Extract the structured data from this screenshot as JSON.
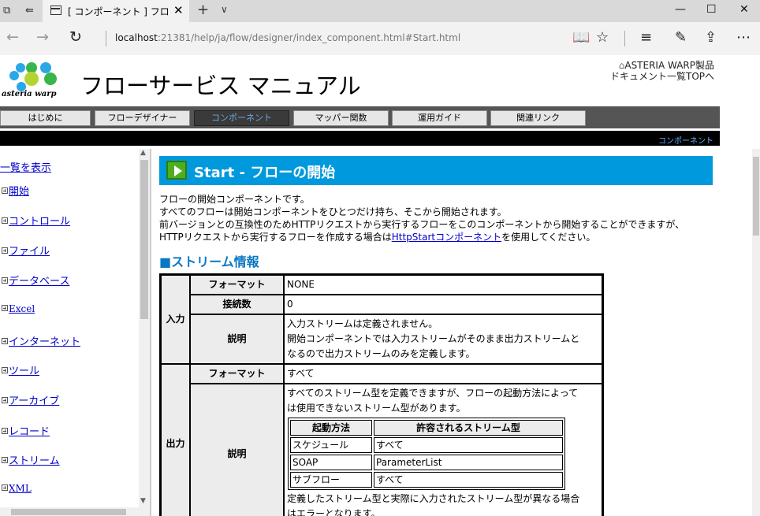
{
  "browser": {
    "tab_title": "[ コンポーネント ] フローサービ",
    "url_host": "localhost",
    "url_rest": ":21381/help/ja/flow/designer/index_component.html#Start.html"
  },
  "header": {
    "logo_text": "asteria warp",
    "title": "フローサービス マニュアル",
    "top_link_line1": "ASTERIA WARP製品",
    "top_link_line2": "ドキュメント一覧TOPへ"
  },
  "menu": {
    "items": [
      {
        "label": "はじめに"
      },
      {
        "label": "フローデザイナー"
      },
      {
        "label": "コンポーネント"
      },
      {
        "label": "マッパー関数"
      },
      {
        "label": "運用ガイド"
      },
      {
        "label": "関連リンク"
      }
    ]
  },
  "breadcrumb": "コンポーネント",
  "sidebar": {
    "show_list": "一覧を表示",
    "items": [
      {
        "label": "開始"
      },
      {
        "label": "コントロール"
      },
      {
        "label": "ファイル"
      },
      {
        "label": "データベース"
      },
      {
        "label": "Excel"
      },
      {
        "label": "インターネット"
      },
      {
        "label": "ツール"
      },
      {
        "label": "アーカイブ"
      },
      {
        "label": "レコード"
      },
      {
        "label": "ストリーム"
      },
      {
        "label": "XML"
      }
    ]
  },
  "main": {
    "heading": "Start - フローの開始",
    "intro": {
      "line1": "フローの開始コンポーネントです。",
      "line2": "すべてのフローは開始コンポーネントをひとつだけ持ち、そこから開始されます。",
      "line3": "前バージョンとの互換性のためHTTPリクエストから実行するフローをこのコンポーネントから開始することができますが、",
      "line4_pre": "HTTPリクエストから実行するフローを作成する場合は",
      "line4_link": "HttpStartコンポーネント",
      "line4_post": "を使用してください。"
    },
    "section_title": "■ストリーム情報",
    "stream_table": {
      "input_label": "入力",
      "output_label": "出力",
      "format_label": "フォーマット",
      "connections_label": "接続数",
      "description_label": "説明",
      "input_format": "NONE",
      "input_connections": "0",
      "input_desc_line1": "入力ストリームは定義されません。",
      "input_desc_line2": "開始コンポーネントでは入力ストリームがそのまま出力ストリームと",
      "input_desc_line3": "なるので出力ストリームのみを定義します。",
      "output_format": "すべて",
      "output_desc_line1": "すべてのストリーム型を定義できますが、フローの起動方法によって",
      "output_desc_line2": "は使用できないストリーム型があります。",
      "inner_headers": [
        "起動方法",
        "許容されるストリーム型"
      ],
      "inner_rows": [
        [
          "スケジュール",
          "すべて"
        ],
        [
          "SOAP",
          "ParameterList"
        ],
        [
          "サブフロー",
          "すべて"
        ]
      ],
      "output_desc_line3": "定義したストリーム型と実際に入力されたストリーム型が異なる場合",
      "output_desc_line4": "はエラーとなります。"
    }
  }
}
